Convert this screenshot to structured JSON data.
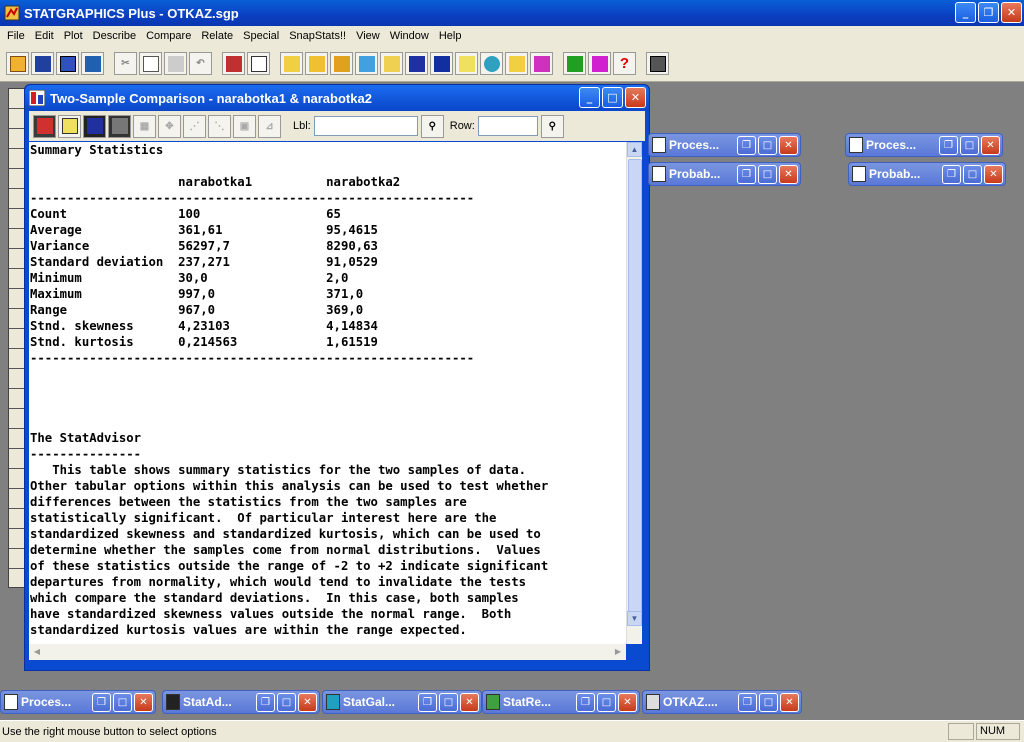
{
  "app": {
    "title": "STATGRAPHICS Plus - OTKAZ.sgp"
  },
  "menu": [
    "File",
    "Edit",
    "Plot",
    "Describe",
    "Compare",
    "Relate",
    "Special",
    "SnapStats!!",
    "View",
    "Window",
    "Help"
  ],
  "child_window": {
    "title": "Two-Sample Comparison - narabotka1 & narabotka2",
    "lbl_label": "Lbl:",
    "lbl_value": "",
    "row_label": "Row:",
    "row_value": ""
  },
  "report": {
    "heading": "Summary Statistics",
    "columns": [
      "narabotka1",
      "narabotka2"
    ],
    "rows": [
      {
        "label": "Count",
        "v1": "100",
        "v2": "65"
      },
      {
        "label": "Average",
        "v1": "361,61",
        "v2": "95,4615"
      },
      {
        "label": "Variance",
        "v1": "56297,7",
        "v2": "8290,63"
      },
      {
        "label": "Standard deviation",
        "v1": "237,271",
        "v2": "91,0529"
      },
      {
        "label": "Minimum",
        "v1": "30,0",
        "v2": "2,0"
      },
      {
        "label": "Maximum",
        "v1": "997,0",
        "v2": "371,0"
      },
      {
        "label": "Range",
        "v1": "967,0",
        "v2": "369,0"
      },
      {
        "label": "Stnd. skewness",
        "v1": "4,23103",
        "v2": "4,14834"
      },
      {
        "label": "Stnd. kurtosis",
        "v1": "0,214563",
        "v2": "1,61519"
      }
    ],
    "advisor_heading": "The StatAdvisor",
    "advisor_text": [
      "   This table shows summary statistics for the two samples of data.",
      "Other tabular options within this analysis can be used to test whether",
      "differences between the statistics from the two samples are",
      "statistically significant.  Of particular interest here are the",
      "standardized skewness and standardized kurtosis, which can be used to",
      "determine whether the samples come from normal distributions.  Values",
      "of these statistics outside the range of -2 to +2 indicate significant",
      "departures from normality, which would tend to invalidate the tests",
      "which compare the standard deviations.  In this case, both samples",
      "have standardized skewness values outside the normal range.  Both",
      "standardized kurtosis values are within the range expected."
    ]
  },
  "minimized_windows": {
    "right": [
      "Proces...",
      "Proces...",
      "Probab...",
      "Probab..."
    ],
    "bottom": [
      "Proces...",
      "StatAd...",
      "StatGal...",
      "StatRe...",
      "OTKAZ...."
    ]
  },
  "statusbar": {
    "message": "Use the right mouse button to select options",
    "num": "NUM"
  },
  "colors": {
    "xp_title_blue": "#0a46c8",
    "workspace_gray": "#808080",
    "close_red": "#c63a1a"
  }
}
